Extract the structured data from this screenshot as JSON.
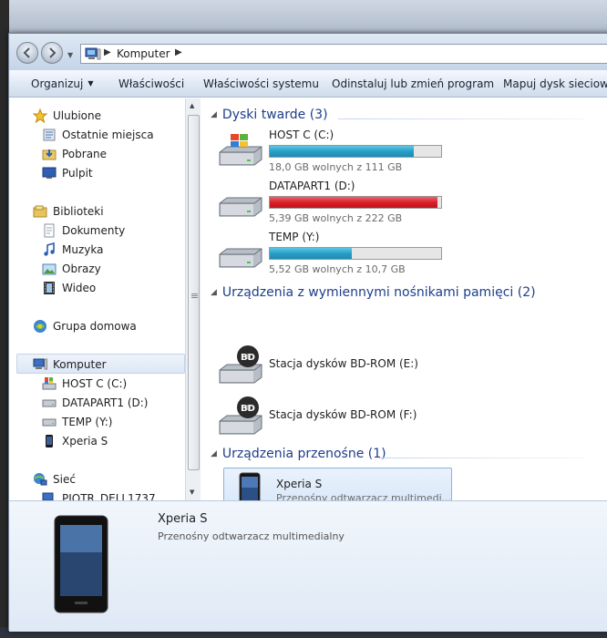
{
  "window": {
    "breadcrumb": "Komputer"
  },
  "toolbar": {
    "organize": "Organizuj",
    "properties": "Właściwości",
    "system_properties": "Właściwości systemu",
    "uninstall": "Odinstaluj lub zmień program",
    "map_drive": "Mapuj dysk sieciowy"
  },
  "sidebar": {
    "favorites": "Ulubione",
    "recent": "Ostatnie miejsca",
    "downloads": "Pobrane",
    "desktop": "Pulpit",
    "libraries": "Biblioteki",
    "documents": "Dokumenty",
    "music": "Muzyka",
    "pictures": "Obrazy",
    "video": "Wideo",
    "homegroup": "Grupa domowa",
    "computer": "Komputer",
    "host_c": "HOST C (C:)",
    "datapart1": "DATAPART1 (D:)",
    "temp": "TEMP (Y:)",
    "xperia": "Xperia S",
    "network": "Sieć",
    "network_pc": "PIOTR_DELL1737"
  },
  "content": {
    "group_hdd": "Dyski twarde (3)",
    "group_removable": "Urządzenia z wymiennymi nośnikami pamięci (2)",
    "group_portable": "Urządzenia przenośne (1)",
    "drives": [
      {
        "name": "HOST C (C:)",
        "free": "18,0 GB wolnych z 111 GB",
        "used_fraction": 0.84,
        "bar_color": "blue"
      },
      {
        "name": "DATAPART1 (D:)",
        "free": "5,39 GB wolnych z 222 GB",
        "used_fraction": 0.98,
        "bar_color": "red"
      },
      {
        "name": "TEMP (Y:)",
        "free": "5,52 GB wolnych z 10,7 GB",
        "used_fraction": 0.48,
        "bar_color": "blue"
      }
    ],
    "optical": [
      {
        "name": "Stacja dysków BD-ROM (E:)",
        "icon_label": "BD"
      },
      {
        "name": "Stacja dysków BD-ROM (F:)",
        "icon_label": "BD"
      }
    ],
    "portable": {
      "name": "Xperia S",
      "desc": "Przenośny odtwarzacz multimedi..."
    }
  },
  "details": {
    "name": "Xperia S",
    "desc": "Przenośny odtwarzacz multimedialny"
  },
  "colors": {
    "link_blue": "#1e3d8a",
    "bar_blue": "#2a9ec6",
    "bar_red": "#d8202a"
  }
}
